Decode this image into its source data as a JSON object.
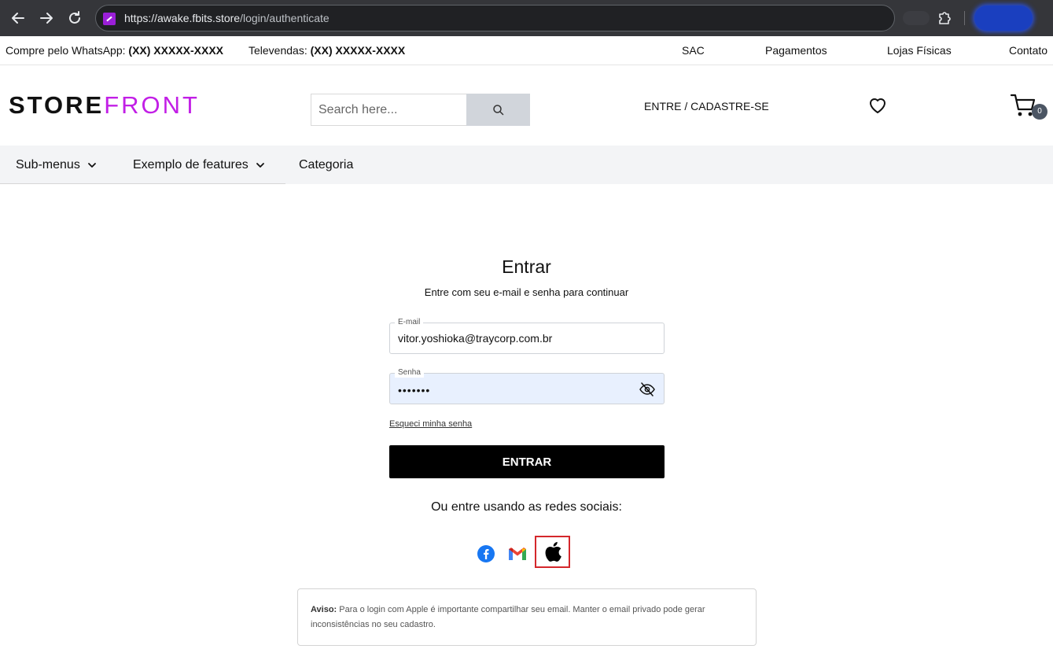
{
  "browser": {
    "url_host": "https://awake.fbits.store",
    "url_path": "/login/authenticate",
    "icons": [
      "back-icon",
      "forward-icon",
      "reload-icon",
      "site-favicon",
      "extensions-icon",
      "profile-chip"
    ]
  },
  "topbar": {
    "whatsapp_label": "Compre pelo WhatsApp:",
    "whatsapp_number": "(XX) XXXXX-XXXX",
    "televendas_label": "Televendas:",
    "televendas_number": "(XX) XXXXX-XXXX",
    "links": [
      "SAC",
      "Pagamentos",
      "Lojas Físicas",
      "Contato"
    ]
  },
  "header": {
    "logo_part1": "STORE",
    "logo_part2": "FRONT",
    "search_placeholder": "Search here...",
    "login_link": "ENTRE / CADASTRE-SE",
    "cart_count": "0"
  },
  "menu": {
    "items": [
      "Sub-menus",
      "Exemplo de features",
      "Categoria"
    ]
  },
  "login": {
    "title": "Entrar",
    "subtitle": "Entre com seu e-mail e senha para continuar",
    "email_label": "E-mail",
    "email_value": "vitor.yoshioka@traycorp.com.br",
    "password_label": "Senha",
    "password_mask": "•••••••",
    "forgot_link": "Esqueci minha senha",
    "submit_label": "ENTRAR",
    "social_text": "Ou entre usando as redes sociais:"
  },
  "notice": {
    "label": "Aviso:",
    "text": "Para o login com Apple é importante compartilhar seu email. Manter o email privado pode gerar inconsistências no seu cadastro."
  },
  "colors": {
    "brand_accent": "#c21fe6",
    "button_bg": "#000000",
    "menubar_bg": "#f3f4f6",
    "highlight_border": "#d4272c",
    "autofill_bg": "#e8f0fe"
  }
}
